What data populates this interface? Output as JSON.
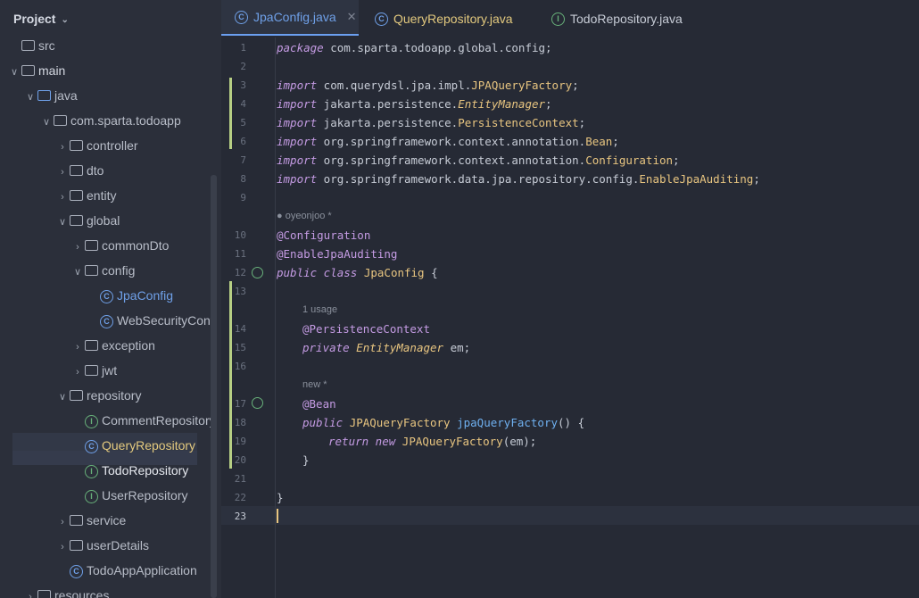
{
  "project": {
    "title": "Project",
    "tree": [
      {
        "label": "src",
        "icon": "folder-icon",
        "arrow": ""
      },
      {
        "label": "main",
        "icon": "folder-icon",
        "arrow": "v"
      },
      {
        "label": "java",
        "icon": "folder-blue-icon",
        "arrow": "v"
      },
      {
        "label": "com.sparta.todoapp",
        "icon": "package-icon",
        "arrow": "v"
      },
      {
        "label": "controller",
        "icon": "package-icon",
        "arrow": ">"
      },
      {
        "label": "dto",
        "icon": "package-icon",
        "arrow": ">"
      },
      {
        "label": "entity",
        "icon": "package-icon",
        "arrow": ">"
      },
      {
        "label": "global",
        "icon": "package-icon",
        "arrow": "v"
      },
      {
        "label": "commonDto",
        "icon": "package-icon",
        "arrow": ">"
      },
      {
        "label": "config",
        "icon": "package-icon",
        "arrow": "v"
      },
      {
        "label": "JpaConfig",
        "icon": "class-icon",
        "arrow": ""
      },
      {
        "label": "WebSecurityConf",
        "icon": "class-icon",
        "arrow": ""
      },
      {
        "label": "exception",
        "icon": "package-icon",
        "arrow": ">"
      },
      {
        "label": "jwt",
        "icon": "package-icon",
        "arrow": ">"
      },
      {
        "label": "repository",
        "icon": "package-icon",
        "arrow": "v"
      },
      {
        "label": "CommentRepository",
        "icon": "interface-icon",
        "arrow": ""
      },
      {
        "label": "QueryRepository",
        "icon": "class-icon",
        "arrow": ""
      },
      {
        "label": "TodoRepository",
        "icon": "interface-icon",
        "arrow": ""
      },
      {
        "label": "UserRepository",
        "icon": "interface-icon",
        "arrow": ""
      },
      {
        "label": "service",
        "icon": "package-icon",
        "arrow": ">"
      },
      {
        "label": "userDetails",
        "icon": "package-icon",
        "arrow": ">"
      },
      {
        "label": "TodoAppApplication",
        "icon": "app-class-icon",
        "arrow": ""
      },
      {
        "label": "resources",
        "icon": "folder-icon",
        "arrow": ">"
      }
    ]
  },
  "tabs": [
    {
      "label": "JpaConfig.java",
      "icon": "class-icon",
      "active": true
    },
    {
      "label": "QueryRepository.java",
      "icon": "class-icon",
      "active": false
    },
    {
      "label": "TodoRepository.java",
      "icon": "interface-icon",
      "active": false
    }
  ],
  "editor": {
    "hints": {
      "author": "oyeonjoo *",
      "usage": "1 usage",
      "new_hint": "new *"
    },
    "lines": [
      "1",
      "2",
      "3",
      "4",
      "5",
      "6",
      "7",
      "8",
      "9",
      "10",
      "11",
      "12",
      "13",
      "14",
      "15",
      "16",
      "17",
      "18",
      "19",
      "20",
      "21",
      "22",
      "23"
    ],
    "code": {
      "l1_kw": "package",
      "l1_rest": " com.sparta.todoapp.global.config;",
      "imp": "import",
      "l3": " com.querydsl.jpa.impl.",
      "l3_c": "JPAQueryFactory",
      "l4": " jakarta.persistence.",
      "l4_c": "EntityManager",
      "l5": " jakarta.persistence.",
      "l5_c": "PersistenceContext",
      "l6": " org.springframework.context.annotation.",
      "l6_c": "Bean",
      "l7": " org.springframework.context.annotation.",
      "l7_c": "Configuration",
      "l8": " org.springframework.data.jpa.repository.config.",
      "l8_c": "EnableJpaAuditing",
      "l10": "@Configuration",
      "l11": "@EnableJpaAuditing",
      "l12_kw": "public class",
      "l12_c": "JpaConfig",
      "l12_b": " {",
      "l14": "@PersistenceContext",
      "l15_kw": "private",
      "l15_c": "EntityManager",
      "l15_v": " em;",
      "l17": "@Bean",
      "l18_kw": "public",
      "l18_c": "JPAQueryFactory",
      "l18_f": "jpaQueryFactory",
      "l18_p": "() {",
      "l19_kw": "return new",
      "l19_c": "JPAQueryFactory",
      "l19_p": "(em);",
      "l20": "}",
      "l22": "}"
    }
  }
}
